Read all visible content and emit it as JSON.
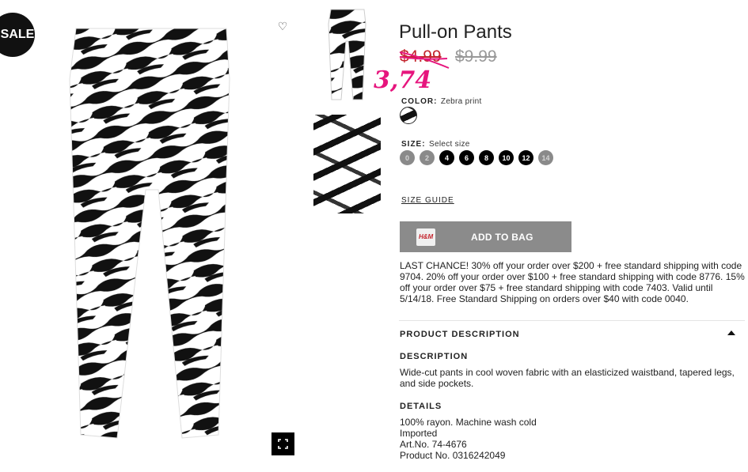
{
  "badge": {
    "text": "SALE"
  },
  "product": {
    "title": "Pull-on Pants",
    "sale_price": "$4.99",
    "original_price": "$9.99",
    "handwritten_price": "3,74"
  },
  "color": {
    "label": "COLOR:",
    "value": "Zebra print"
  },
  "size": {
    "label": "SIZE:",
    "value": "Select size",
    "options": [
      {
        "label": "0",
        "available": false
      },
      {
        "label": "2",
        "available": false
      },
      {
        "label": "4",
        "available": true
      },
      {
        "label": "6",
        "available": true
      },
      {
        "label": "8",
        "available": true
      },
      {
        "label": "10",
        "available": true
      },
      {
        "label": "12",
        "available": true
      },
      {
        "label": "14",
        "available": false
      }
    ]
  },
  "size_guide": "SIZE GUIDE",
  "add_to_bag": "ADD TO BAG",
  "promo": "LAST CHANCE! 30% off your order over $200 + free standard shipping with code 9704. 20% off your order over $100 + free standard shipping with code 8776. 15% off your order over $75 + free standard shipping with code 7403. Valid until 5/14/18. Free Standard Shipping on orders over $40 with code 0040.",
  "product_description": {
    "heading": "PRODUCT DESCRIPTION",
    "description_heading": "DESCRIPTION",
    "description_text": "Wide-cut pants in cool woven fabric with an elasticized waistband, tapered legs, and side pockets.",
    "details_heading": "DETAILS",
    "details_lines": [
      "100% rayon. Machine wash cold",
      "Imported",
      "Art.No. 74-4676",
      "Product No. 0316242049"
    ]
  },
  "icons": {
    "favorite": "heart-icon",
    "fullscreen": "fullscreen-icon",
    "collapse": "caret-up-icon",
    "bag": "shopping-bag-icon"
  },
  "colors": {
    "sale_red": "#c3232c",
    "handwritten_pink": "#e6157d",
    "button_grey": "#8b8b8b"
  }
}
